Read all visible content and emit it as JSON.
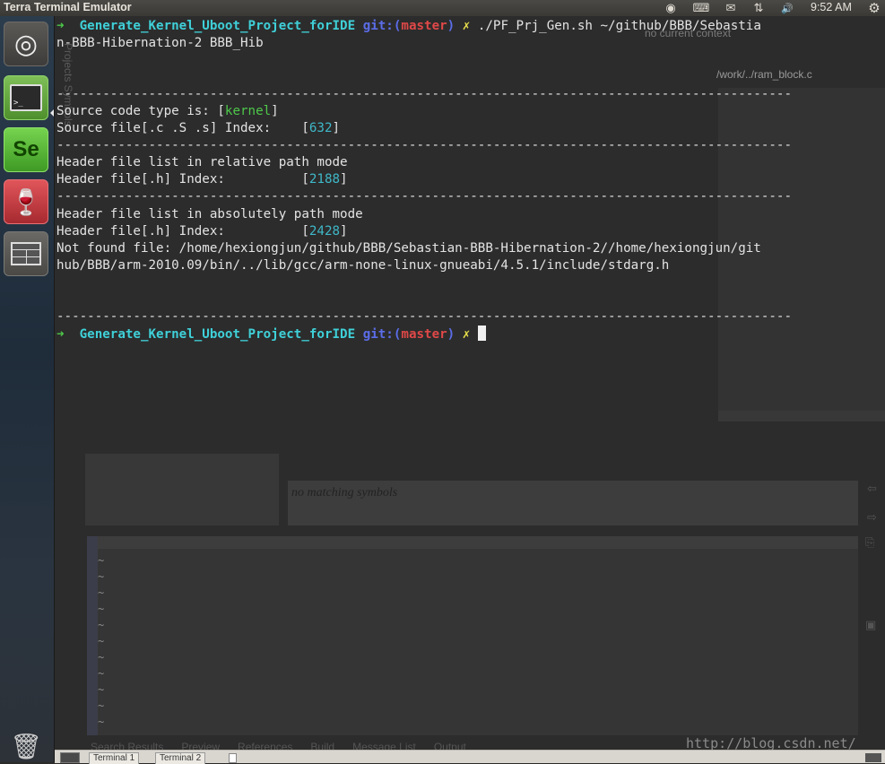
{
  "top_panel": {
    "app_title": "Terra Terminal Emulator",
    "clock": "9:52 AM",
    "tray_icons": [
      "chrome-icon",
      "keyboard-icon",
      "mail-icon",
      "network-icon",
      "volume-icon",
      "settings-gear-icon"
    ],
    "tray_glyphs": [
      "◉",
      "⌨",
      "✉",
      "⇅",
      "🔊",
      "⚙"
    ]
  },
  "launcher": {
    "items": [
      "ubuntu-dash",
      "terminal",
      "slickedit",
      "wine",
      "workspace-switcher",
      "trash"
    ],
    "ubuntu_glyph": "◎",
    "terminal_glyph": ">_",
    "slickedit_glyph": "Se",
    "wine_glyph": "🍷",
    "trash_glyph": "🗑"
  },
  "terminal": {
    "prompt": {
      "arrow": "➜",
      "dir": "Generate_Kernel_Uboot_Project_forIDE",
      "git_label": "git:(",
      "branch": "master",
      "git_close": ")",
      "dirty": "✗"
    },
    "command_part1": "./PF_Prj_Gen.sh ~/github/BBB/Sebastia",
    "command_part2": "n-BBB-Hibernation-2 BBB_Hib",
    "separator": "------------------------------------------------------------------------------------------------",
    "source_type_label": "Source code type is: [",
    "source_type": "kernel",
    "bracket_close": "]",
    "source_index_label": "Source file[.c .S .s] Index:    [",
    "source_index": "632",
    "rel_title": "Header file list in relative path mode",
    "rel_index_label": "Header file[.h] Index:          [",
    "rel_index": "2188",
    "abs_title": "Header file list in absolutely path mode",
    "abs_index_label": "Header file[.h] Index:          [",
    "abs_index": "2428",
    "not_found_line1": "Not found file: /home/hexiongjun/github/BBB/Sebastian-BBB-Hibernation-2//home/hexiongjun/git",
    "not_found_line2": "hub/BBB/arm-2010.09/bin/../lib/gcc/arm-none-linux-gnueabi/4.5.1/include/stdarg.h"
  },
  "background_ide": {
    "sidebar_text": "Projects  Symbols",
    "path": "/work/../ram_block.c",
    "context": "no current context",
    "no_match": "no matching symbols",
    "bottom_tabs": "Search Results      Preview      References      Build      Message List      Output",
    "watermark": "http://blog.csdn.net/",
    "tilde": "~"
  },
  "bottom_bar": {
    "tab1": "Terminal 1",
    "tab2": "Terminal 2"
  }
}
